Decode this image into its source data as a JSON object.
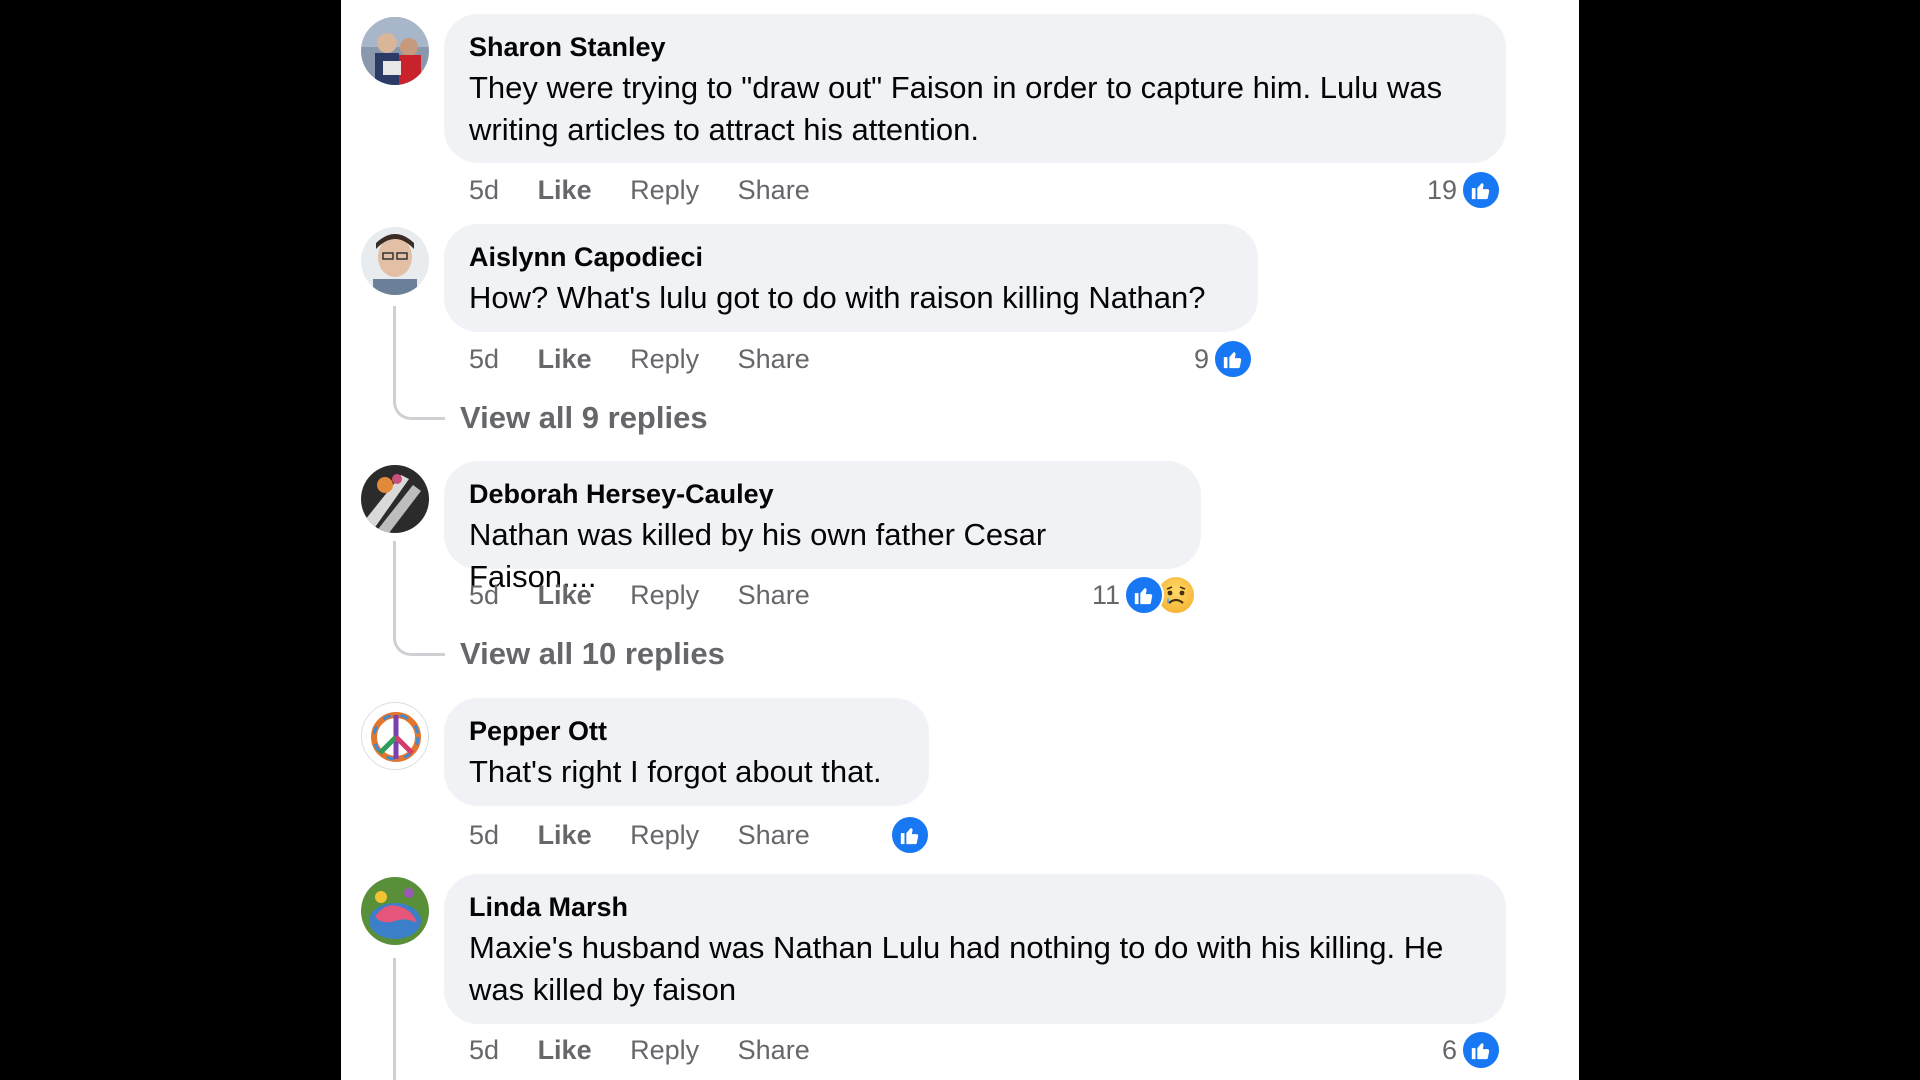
{
  "comments": [
    {
      "author": "Sharon Stanley",
      "text": "They were trying to \"draw out\" Faison in order to capture him. Lulu was writing articles to attract his attention.",
      "time": "5d",
      "like": "Like",
      "reply": "Reply",
      "share": "Share",
      "reaction_count": "19",
      "reactions": [
        "like-icon"
      ]
    },
    {
      "author": "Aislynn Capodieci",
      "text": "How? What's lulu got to do with raison killing Nathan?",
      "time": "5d",
      "like": "Like",
      "reply": "Reply",
      "share": "Share",
      "reaction_count": "9",
      "reactions": [
        "like-icon"
      ],
      "view_replies": "View all 9 replies"
    },
    {
      "author": "Deborah Hersey-Cauley",
      "text": "Nathan was killed by his own father Cesar Faison....",
      "time": "5d",
      "like": "Like",
      "reply": "Reply",
      "share": "Share",
      "reaction_count": "11",
      "reactions": [
        "like-icon",
        "sad-icon"
      ],
      "view_replies": "View all 10 replies"
    },
    {
      "author": "Pepper Ott",
      "text": "That's right I forgot about that.",
      "time": "5d",
      "like": "Like",
      "reply": "Reply",
      "share": "Share",
      "reaction_count": "",
      "reactions": [
        "like-icon"
      ]
    },
    {
      "author": "Linda Marsh",
      "text": "Maxie's husband was Nathan Lulu had nothing to do with his killing. He was killed by faison",
      "time": "5d",
      "like": "Like",
      "reply": "Reply",
      "share": "Share",
      "reaction_count": "6",
      "reactions": [
        "like-icon"
      ]
    }
  ],
  "colors": {
    "bubble": "#f0f2f5",
    "like_blue": "#1877f2",
    "secondary_text": "#65676b",
    "primary_text": "#050505"
  }
}
